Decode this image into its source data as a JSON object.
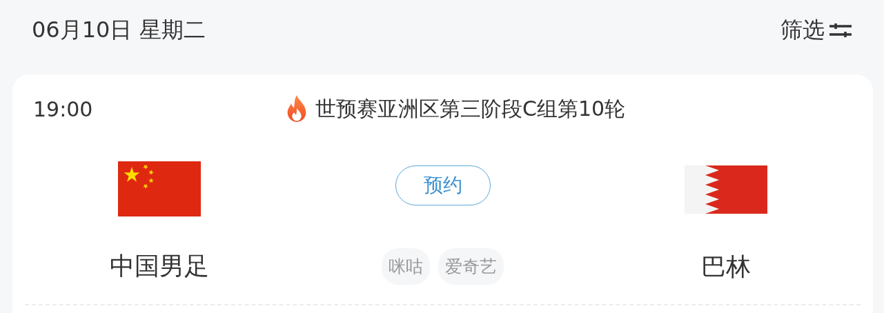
{
  "header": {
    "date": "06月10日 星期二",
    "filter_label": "筛选"
  },
  "match": {
    "time": "19:00",
    "competition": "世预赛亚洲区第三阶段C组第10轮",
    "hot": true,
    "home": {
      "name": "中国男足",
      "kind": "china"
    },
    "action": {
      "label": "预约"
    },
    "away": {
      "name": "巴林",
      "kind": "bahrain"
    },
    "broadcasters": [
      "咪咕",
      "爱奇艺"
    ]
  }
}
